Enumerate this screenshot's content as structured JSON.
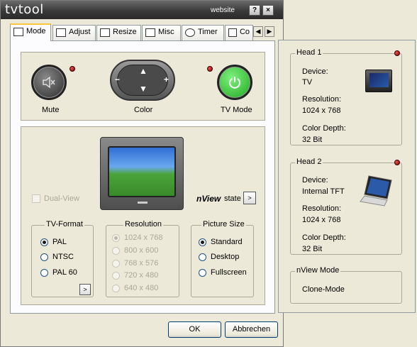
{
  "window": {
    "title": "tvtool",
    "website_label": "website",
    "help_btn": "?",
    "close_btn": "×"
  },
  "tabs": [
    {
      "label": "Mode",
      "icon": "mode-icon",
      "active": true
    },
    {
      "label": "Adjust",
      "icon": "adjust-icon"
    },
    {
      "label": "Resize",
      "icon": "resize-icon"
    },
    {
      "label": "Misc",
      "icon": "misc-icon"
    },
    {
      "label": "Timer",
      "icon": "timer-icon"
    },
    {
      "label": "Co",
      "icon": "config-icon"
    }
  ],
  "tab_scroll": {
    "left": "◀",
    "right": "▶"
  },
  "controls": {
    "mute_label": "Mute",
    "color_label": "Color",
    "tvmode_label": "TV Mode",
    "pad_up": "▲",
    "pad_down": "▼",
    "pad_minus": "−",
    "pad_plus": "+"
  },
  "dual_view_label": "Dual-View",
  "nview_brand": "nView",
  "nview_state_label": "state",
  "nview_state_btn": ">",
  "tv_format": {
    "legend": "TV-Format",
    "options": [
      "PAL",
      "NTSC",
      "PAL 60"
    ],
    "selected": "PAL",
    "more_btn": ">"
  },
  "resolution": {
    "legend": "Resolution",
    "options": [
      "1024 x 768",
      "800 x 600",
      "768 x 576",
      "720 x 480",
      "640 x 480"
    ],
    "selected": "1024 x 768"
  },
  "picture_size": {
    "legend": "Picture Size",
    "options": [
      "Standard",
      "Desktop",
      "Fullscreen"
    ],
    "selected": "Standard"
  },
  "footer": {
    "ok": "OK",
    "cancel": "Abbrechen"
  },
  "heads": [
    {
      "legend": "Head 1",
      "device_label": "Device:",
      "device": "TV",
      "resolution_label": "Resolution:",
      "resolution": "1024 x 768",
      "depth_label": "Color Depth:",
      "depth": "32 Bit"
    },
    {
      "legend": "Head 2",
      "device_label": "Device:",
      "device": "Internal TFT",
      "resolution_label": "Resolution:",
      "resolution": "1024 x 768",
      "depth_label": "Color Depth:",
      "depth": "32 Bit"
    }
  ],
  "nview_mode": {
    "legend": "nView Mode",
    "value": "Clone-Mode"
  },
  "colors": {
    "tvmode_green": "#2fc02f",
    "led_red": "#cc2222",
    "title_dark": "#3a3a3a"
  }
}
